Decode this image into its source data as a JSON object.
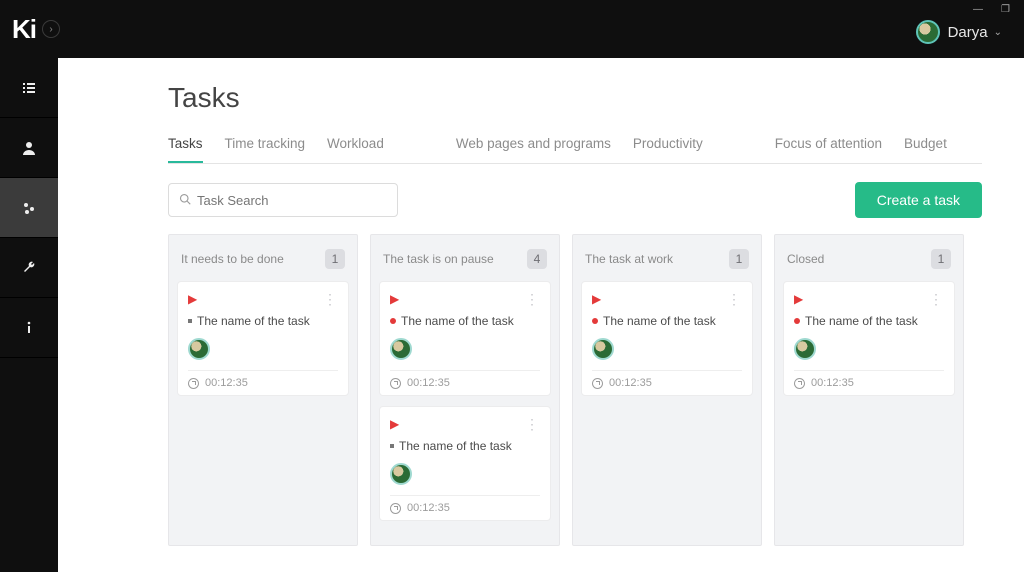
{
  "app": {
    "logo": "Ki"
  },
  "window_controls": {
    "minimize": "—",
    "maximize": "❐"
  },
  "user": {
    "name": "Darya"
  },
  "sidebar": {
    "items": [
      {
        "id": "list",
        "active": false
      },
      {
        "id": "user",
        "active": false
      },
      {
        "id": "settings",
        "active": true
      },
      {
        "id": "tools",
        "active": false
      },
      {
        "id": "info",
        "active": false
      }
    ]
  },
  "page": {
    "title": "Tasks"
  },
  "tabs": [
    {
      "label": "Tasks",
      "active": true
    },
    {
      "label": "Time tracking"
    },
    {
      "label": "Workload"
    },
    {
      "label": "Web pages and programs"
    },
    {
      "label": "Productivity"
    },
    {
      "label": "Focus of attention"
    },
    {
      "label": "Budget"
    }
  ],
  "search": {
    "placeholder": "Task Search"
  },
  "create_button": "Create a task",
  "columns": [
    {
      "title": "It needs to be done",
      "count": "1",
      "cards": [
        {
          "name": "The name of the task",
          "time": "00:12:35",
          "bullet": "neutral"
        }
      ]
    },
    {
      "title": "The task is on pause",
      "count": "4",
      "cards": [
        {
          "name": "The name of the task",
          "time": "00:12:35",
          "bullet": "red"
        },
        {
          "name": "The name of the task",
          "time": "00:12:35",
          "bullet": "neutral"
        }
      ]
    },
    {
      "title": "The task at work",
      "count": "1",
      "cards": [
        {
          "name": "The name of the task",
          "time": "00:12:35",
          "bullet": "red"
        }
      ]
    },
    {
      "title": "Closed",
      "count": "1",
      "cards": [
        {
          "name": "The name of the task",
          "time": "00:12:35",
          "bullet": "red"
        }
      ]
    }
  ],
  "colors": {
    "accent": "#26bb88",
    "danger": "#e43a3a"
  }
}
